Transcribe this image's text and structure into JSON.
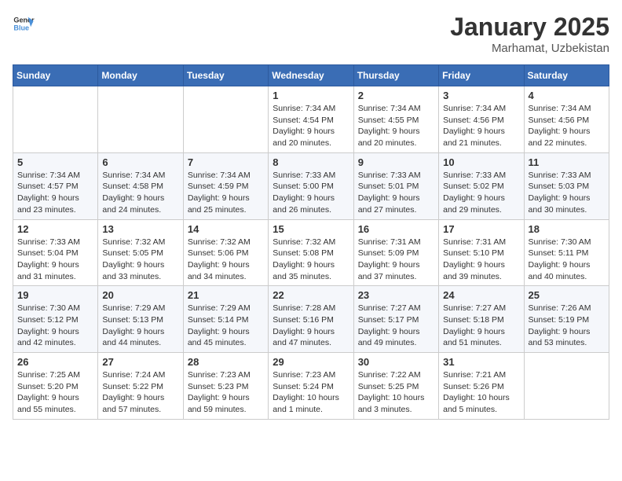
{
  "header": {
    "logo_general": "General",
    "logo_blue": "Blue",
    "month": "January 2025",
    "location": "Marhamat, Uzbekistan"
  },
  "weekdays": [
    "Sunday",
    "Monday",
    "Tuesday",
    "Wednesday",
    "Thursday",
    "Friday",
    "Saturday"
  ],
  "weeks": [
    [
      {
        "day": "",
        "info": ""
      },
      {
        "day": "",
        "info": ""
      },
      {
        "day": "",
        "info": ""
      },
      {
        "day": "1",
        "info": "Sunrise: 7:34 AM\nSunset: 4:54 PM\nDaylight: 9 hours\nand 20 minutes."
      },
      {
        "day": "2",
        "info": "Sunrise: 7:34 AM\nSunset: 4:55 PM\nDaylight: 9 hours\nand 20 minutes."
      },
      {
        "day": "3",
        "info": "Sunrise: 7:34 AM\nSunset: 4:56 PM\nDaylight: 9 hours\nand 21 minutes."
      },
      {
        "day": "4",
        "info": "Sunrise: 7:34 AM\nSunset: 4:56 PM\nDaylight: 9 hours\nand 22 minutes."
      }
    ],
    [
      {
        "day": "5",
        "info": "Sunrise: 7:34 AM\nSunset: 4:57 PM\nDaylight: 9 hours\nand 23 minutes."
      },
      {
        "day": "6",
        "info": "Sunrise: 7:34 AM\nSunset: 4:58 PM\nDaylight: 9 hours\nand 24 minutes."
      },
      {
        "day": "7",
        "info": "Sunrise: 7:34 AM\nSunset: 4:59 PM\nDaylight: 9 hours\nand 25 minutes."
      },
      {
        "day": "8",
        "info": "Sunrise: 7:33 AM\nSunset: 5:00 PM\nDaylight: 9 hours\nand 26 minutes."
      },
      {
        "day": "9",
        "info": "Sunrise: 7:33 AM\nSunset: 5:01 PM\nDaylight: 9 hours\nand 27 minutes."
      },
      {
        "day": "10",
        "info": "Sunrise: 7:33 AM\nSunset: 5:02 PM\nDaylight: 9 hours\nand 29 minutes."
      },
      {
        "day": "11",
        "info": "Sunrise: 7:33 AM\nSunset: 5:03 PM\nDaylight: 9 hours\nand 30 minutes."
      }
    ],
    [
      {
        "day": "12",
        "info": "Sunrise: 7:33 AM\nSunset: 5:04 PM\nDaylight: 9 hours\nand 31 minutes."
      },
      {
        "day": "13",
        "info": "Sunrise: 7:32 AM\nSunset: 5:05 PM\nDaylight: 9 hours\nand 33 minutes."
      },
      {
        "day": "14",
        "info": "Sunrise: 7:32 AM\nSunset: 5:06 PM\nDaylight: 9 hours\nand 34 minutes."
      },
      {
        "day": "15",
        "info": "Sunrise: 7:32 AM\nSunset: 5:08 PM\nDaylight: 9 hours\nand 35 minutes."
      },
      {
        "day": "16",
        "info": "Sunrise: 7:31 AM\nSunset: 5:09 PM\nDaylight: 9 hours\nand 37 minutes."
      },
      {
        "day": "17",
        "info": "Sunrise: 7:31 AM\nSunset: 5:10 PM\nDaylight: 9 hours\nand 39 minutes."
      },
      {
        "day": "18",
        "info": "Sunrise: 7:30 AM\nSunset: 5:11 PM\nDaylight: 9 hours\nand 40 minutes."
      }
    ],
    [
      {
        "day": "19",
        "info": "Sunrise: 7:30 AM\nSunset: 5:12 PM\nDaylight: 9 hours\nand 42 minutes."
      },
      {
        "day": "20",
        "info": "Sunrise: 7:29 AM\nSunset: 5:13 PM\nDaylight: 9 hours\nand 44 minutes."
      },
      {
        "day": "21",
        "info": "Sunrise: 7:29 AM\nSunset: 5:14 PM\nDaylight: 9 hours\nand 45 minutes."
      },
      {
        "day": "22",
        "info": "Sunrise: 7:28 AM\nSunset: 5:16 PM\nDaylight: 9 hours\nand 47 minutes."
      },
      {
        "day": "23",
        "info": "Sunrise: 7:27 AM\nSunset: 5:17 PM\nDaylight: 9 hours\nand 49 minutes."
      },
      {
        "day": "24",
        "info": "Sunrise: 7:27 AM\nSunset: 5:18 PM\nDaylight: 9 hours\nand 51 minutes."
      },
      {
        "day": "25",
        "info": "Sunrise: 7:26 AM\nSunset: 5:19 PM\nDaylight: 9 hours\nand 53 minutes."
      }
    ],
    [
      {
        "day": "26",
        "info": "Sunrise: 7:25 AM\nSunset: 5:20 PM\nDaylight: 9 hours\nand 55 minutes."
      },
      {
        "day": "27",
        "info": "Sunrise: 7:24 AM\nSunset: 5:22 PM\nDaylight: 9 hours\nand 57 minutes."
      },
      {
        "day": "28",
        "info": "Sunrise: 7:23 AM\nSunset: 5:23 PM\nDaylight: 9 hours\nand 59 minutes."
      },
      {
        "day": "29",
        "info": "Sunrise: 7:23 AM\nSunset: 5:24 PM\nDaylight: 10 hours\nand 1 minute."
      },
      {
        "day": "30",
        "info": "Sunrise: 7:22 AM\nSunset: 5:25 PM\nDaylight: 10 hours\nand 3 minutes."
      },
      {
        "day": "31",
        "info": "Sunrise: 7:21 AM\nSunset: 5:26 PM\nDaylight: 10 hours\nand 5 minutes."
      },
      {
        "day": "",
        "info": ""
      }
    ]
  ]
}
